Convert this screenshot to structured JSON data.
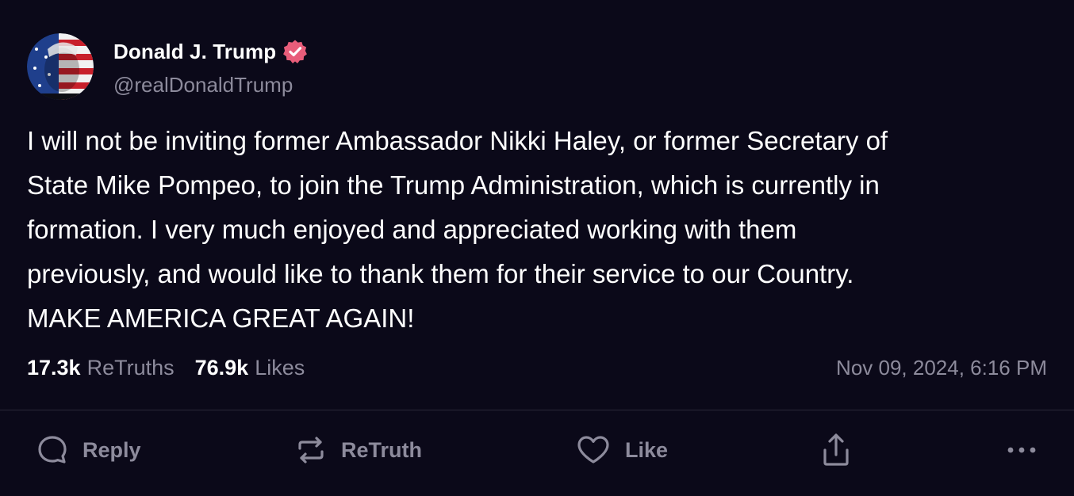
{
  "author": {
    "display_name": "Donald J. Trump",
    "handle": "@realDonaldTrump",
    "verified_icon": "verified-badge-icon",
    "verified_color": "#e85d7a"
  },
  "post": {
    "text": "I will not be inviting former Ambassador Nikki Haley, or former Secretary of\nState Mike Pompeo, to join the Trump Administration, which is currently in\nformation. I very much enjoyed and appreciated working with them\npreviously, and would like to thank them for their service to our Country.\nMAKE AMERICA GREAT AGAIN!",
    "retruths_count": "17.3k",
    "retruths_label": "ReTruths",
    "likes_count": "76.9k",
    "likes_label": "Likes",
    "timestamp": "Nov 09, 2024, 6:16 PM"
  },
  "actions": {
    "reply": "Reply",
    "retruth": "ReTruth",
    "like": "Like"
  },
  "colors": {
    "background": "#0b0919",
    "muted_text": "#8d8b9c",
    "divider": "#2a2838"
  }
}
